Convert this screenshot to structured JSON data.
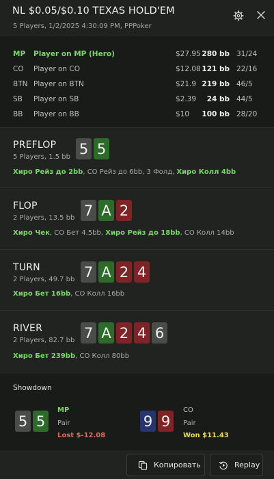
{
  "header": {
    "title": "NL $0.05/$0.10 TEXAS HOLD'EM",
    "subtitle": "5 Players, 1/2/2025 4:30:09 PM, PPPoker",
    "icons": {
      "settings": "gear-icon",
      "close": "close-icon"
    }
  },
  "players": [
    {
      "pos": "MP",
      "name": "Player on MP (Hero)",
      "money": "$27.95",
      "bb": "280 bb",
      "stat": "31/24",
      "hero": true
    },
    {
      "pos": "CO",
      "name": "Player on CO",
      "money": "$12.08",
      "bb": "121 bb",
      "stat": "22/16"
    },
    {
      "pos": "BTN",
      "name": "Player on BTN",
      "money": "$21.9",
      "bb": "219 bb",
      "stat": "46/5"
    },
    {
      "pos": "SB",
      "name": "Player on SB",
      "money": "$2.39",
      "bb": "24 bb",
      "stat": "44/5"
    },
    {
      "pos": "BB",
      "name": "Player on BB",
      "money": "$10",
      "bb": "100 bb",
      "stat": "28/20"
    }
  ],
  "streets": [
    {
      "name": "PREFLOP",
      "sub": "5 Players, 1.5 bb",
      "cards": [
        {
          "rank": "5",
          "color": "gray"
        },
        {
          "rank": "5",
          "color": "green"
        }
      ],
      "actions": [
        {
          "text": "Хиро Рейз до 2bb",
          "hero": true
        },
        {
          "text": ", CO Рейз до 6bb, 3 Фолд, ",
          "hero": false
        },
        {
          "text": "Хиро Колл 4bb",
          "hero": true
        }
      ]
    },
    {
      "name": "FLOP",
      "sub": "2 Players, 13.5 bb",
      "cards": [
        {
          "rank": "7",
          "color": "gray"
        },
        {
          "rank": "A",
          "color": "green"
        },
        {
          "rank": "2",
          "color": "red"
        }
      ],
      "actions": [
        {
          "text": "Хиро Чек",
          "hero": true
        },
        {
          "text": ", CO Бет 4.5bb, ",
          "hero": false
        },
        {
          "text": "Хиро Рейз до 18bb",
          "hero": true
        },
        {
          "text": ", CO Колл 14bb",
          "hero": false
        }
      ]
    },
    {
      "name": "TURN",
      "sub": "2 Players, 49.7 bb",
      "cards": [
        {
          "rank": "7",
          "color": "gray"
        },
        {
          "rank": "A",
          "color": "green"
        },
        {
          "rank": "2",
          "color": "red"
        },
        {
          "rank": "4",
          "color": "red"
        }
      ],
      "actions": [
        {
          "text": "Хиро Бет 16bb",
          "hero": true
        },
        {
          "text": ", CO Колл 16bb",
          "hero": false
        }
      ]
    },
    {
      "name": "RIVER",
      "sub": "2 Players, 82.7 bb",
      "cards": [
        {
          "rank": "7",
          "color": "gray"
        },
        {
          "rank": "A",
          "color": "green"
        },
        {
          "rank": "2",
          "color": "red"
        },
        {
          "rank": "4",
          "color": "red"
        },
        {
          "rank": "6",
          "color": "gray"
        }
      ],
      "actions": [
        {
          "text": "Хиро Бет 239bb",
          "hero": true
        },
        {
          "text": ", CO Колл 80bb",
          "hero": false
        }
      ]
    }
  ],
  "showdown": {
    "title": "Showdown",
    "players": [
      {
        "pos": "MP",
        "hand": "Pair",
        "result": "Lost $-12.08",
        "won": false,
        "cards": [
          {
            "rank": "5",
            "color": "gray"
          },
          {
            "rank": "5",
            "color": "green"
          }
        ]
      },
      {
        "pos": "CO",
        "hand": "Pair",
        "result": "Won $11.43",
        "won": true,
        "cards": [
          {
            "rank": "9",
            "color": "blue"
          },
          {
            "rank": "9",
            "color": "red"
          }
        ]
      }
    ]
  },
  "footer": {
    "copy_label": "Копировать",
    "replay_label": "Replay"
  },
  "colors": {
    "hero_green": "#7bd66c",
    "card_gray": "#4a4c4a",
    "card_green": "#2d6b2b",
    "card_red": "#7e2426",
    "card_blue": "#27356e",
    "lost": "#e06a5d",
    "won": "#f0d76b"
  }
}
